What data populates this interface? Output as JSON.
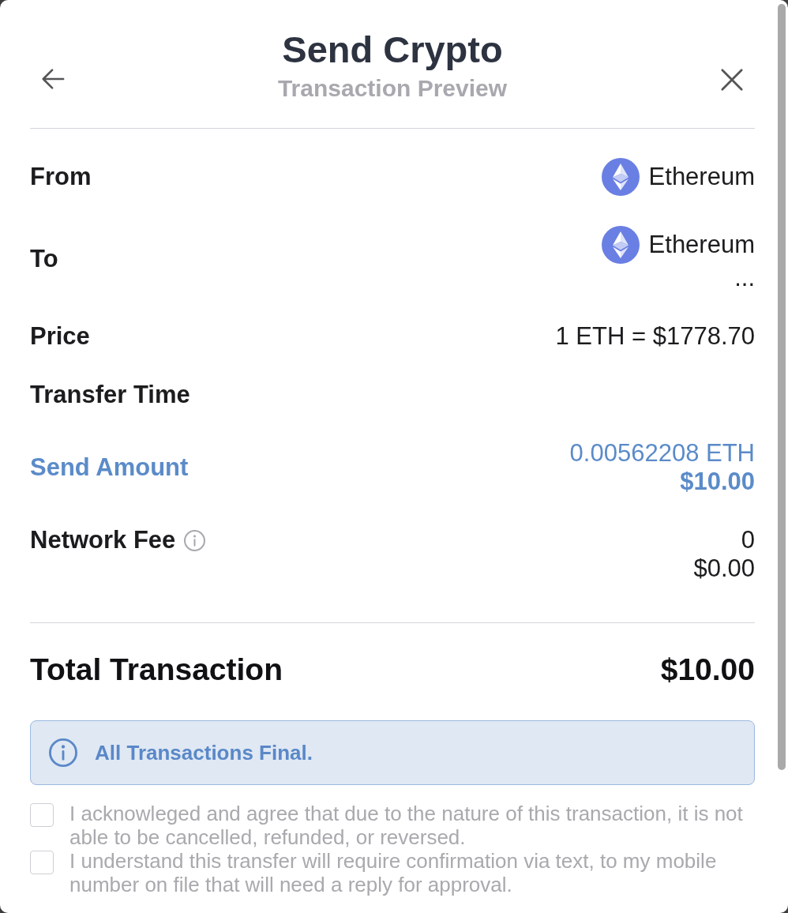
{
  "header": {
    "title": "Send Crypto",
    "subtitle": "Transaction Preview"
  },
  "rows": [
    {
      "kind": "standard",
      "label": "From",
      "highlighted": false,
      "values": [
        {
          "kind": "asset",
          "text": "Ethereum"
        }
      ]
    },
    {
      "kind": "standard",
      "label": "To",
      "highlighted": false,
      "values": [
        {
          "kind": "asset",
          "text": "Ethereum"
        },
        {
          "kind": "plain",
          "text": "..."
        }
      ]
    },
    {
      "kind": "standard",
      "label": "Price",
      "highlighted": false,
      "values": [
        {
          "kind": "plain",
          "text": "1 ETH = $1778.70"
        }
      ]
    },
    {
      "kind": "standard",
      "label": "Transfer Time",
      "highlighted": false
    },
    {
      "kind": "standard",
      "label": "Send Amount",
      "highlighted": true,
      "values": [
        {
          "kind": "plain",
          "text": "0.00562208 ETH"
        },
        {
          "kind": "bold",
          "text": "$10.00"
        }
      ]
    },
    {
      "kind": "fee",
      "label": "Network Fee",
      "highlighted": false,
      "values": [
        {
          "kind": "plain",
          "text": "0"
        },
        {
          "kind": "plain",
          "text": "$0.00"
        }
      ]
    }
  ],
  "total": {
    "label": "Total Transaction",
    "value": "$10.00"
  },
  "notice": {
    "text": "All Transactions Final."
  },
  "agreements": [
    {
      "text": "I acknowleged and agree that due to the nature of this transaction, it is not able to be cancelled, refunded, or reversed.",
      "checked": false
    },
    {
      "text": "I understand this transfer will require confirmation via text, to my mobile number on file that will need a reply for approval.",
      "checked": false
    }
  ]
}
